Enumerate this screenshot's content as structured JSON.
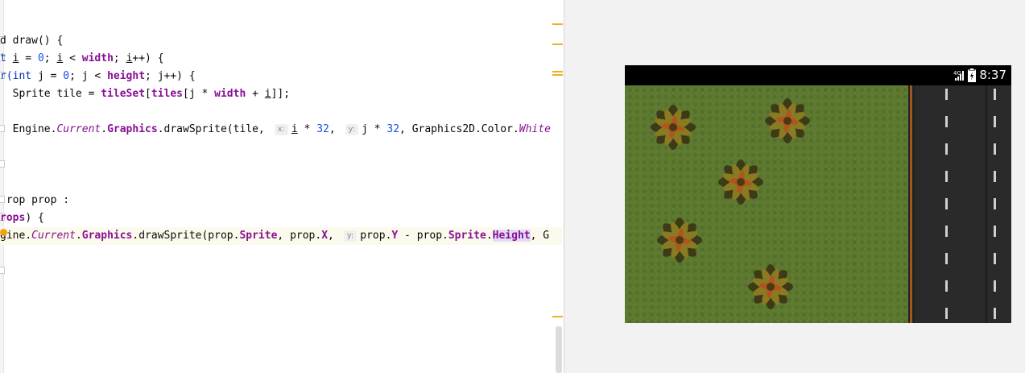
{
  "editor": {
    "lines": [
      {
        "segments": [
          {
            "t": "d draw() {"
          }
        ]
      },
      {
        "segments": [
          {
            "t": "t ",
            "c": "kw"
          },
          {
            "t": "i",
            "c": "var"
          },
          {
            "t": " = "
          },
          {
            "t": "0",
            "c": "num"
          },
          {
            "t": "; "
          },
          {
            "t": "i",
            "c": "var"
          },
          {
            "t": " < "
          },
          {
            "t": "width",
            "c": "fld"
          },
          {
            "t": "; "
          },
          {
            "t": "i",
            "c": "var"
          },
          {
            "t": "++) {"
          }
        ]
      },
      {
        "segments": [
          {
            "t": "r(",
            "c": "kw"
          },
          {
            "t": "int",
            "c": "kw"
          },
          {
            "t": " j = "
          },
          {
            "t": "0",
            "c": "num"
          },
          {
            "t": "; j < "
          },
          {
            "t": "height",
            "c": "fld"
          },
          {
            "t": "; j++) {"
          }
        ]
      },
      {
        "segments": [
          {
            "t": "  Sprite tile = "
          },
          {
            "t": "tileSet",
            "c": "fld"
          },
          {
            "t": "["
          },
          {
            "t": "tiles",
            "c": "fld"
          },
          {
            "t": "[j * "
          },
          {
            "t": "width",
            "c": "fld"
          },
          {
            "t": " + "
          },
          {
            "t": "i",
            "c": "var"
          },
          {
            "t": "]];"
          }
        ]
      },
      {
        "segments": [
          {
            "t": ""
          }
        ]
      },
      {
        "segments": [
          {
            "t": "  Engine."
          },
          {
            "t": "Current",
            "c": "ital"
          },
          {
            "t": "."
          },
          {
            "t": "Graphics",
            "c": "fld"
          },
          {
            "t": ".drawSprite(tile, "
          },
          {
            "hint": "x:"
          },
          {
            "t": "i",
            "c": "var"
          },
          {
            "t": " * "
          },
          {
            "t": "32",
            "c": "num"
          },
          {
            "t": ", "
          },
          {
            "hint": "y:"
          },
          {
            "t": "j * "
          },
          {
            "t": "32",
            "c": "num"
          },
          {
            "t": ", Graphics2D.Color."
          },
          {
            "t": "White",
            "c": "ital"
          }
        ]
      },
      {
        "segments": [
          {
            "t": ""
          }
        ]
      },
      {
        "segments": [
          {
            "t": ""
          }
        ]
      },
      {
        "segments": [
          {
            "t": ""
          }
        ]
      },
      {
        "segments": [
          {
            "t": " rop prop :"
          }
        ]
      },
      {
        "segments": [
          {
            "t": "rops",
            "c": "fld"
          },
          {
            "t": ") {"
          }
        ]
      },
      {
        "current": true,
        "segments": [
          {
            "t": "gine."
          },
          {
            "t": "Current",
            "c": "ital"
          },
          {
            "t": "."
          },
          {
            "t": "Graphics",
            "c": "fld"
          },
          {
            "t": ".drawSprite(prop."
          },
          {
            "t": "Sprite",
            "c": "fld"
          },
          {
            "t": ", prop."
          },
          {
            "t": "X",
            "c": "fld"
          },
          {
            "t": ", "
          },
          {
            "hint": "y:"
          },
          {
            "t": "prop."
          },
          {
            "t": "Y",
            "c": "fld"
          },
          {
            "t": " - prop."
          },
          {
            "t": "Sprite",
            "c": "fld"
          },
          {
            "t": "."
          },
          {
            "t": "Height",
            "c": "fld sel"
          },
          {
            "t": ", G"
          }
        ]
      }
    ]
  },
  "device": {
    "status_time": "8:37",
    "network": "4G",
    "signal_icon": "signal-icon",
    "battery_icon": "battery-icon"
  },
  "colors": {
    "grass": "#5f7b32",
    "road": "#2a2a2a",
    "road_edge": "#a0561c",
    "code_keyword": "#0033b3",
    "code_field": "#871094",
    "code_number": "#1750eb"
  }
}
